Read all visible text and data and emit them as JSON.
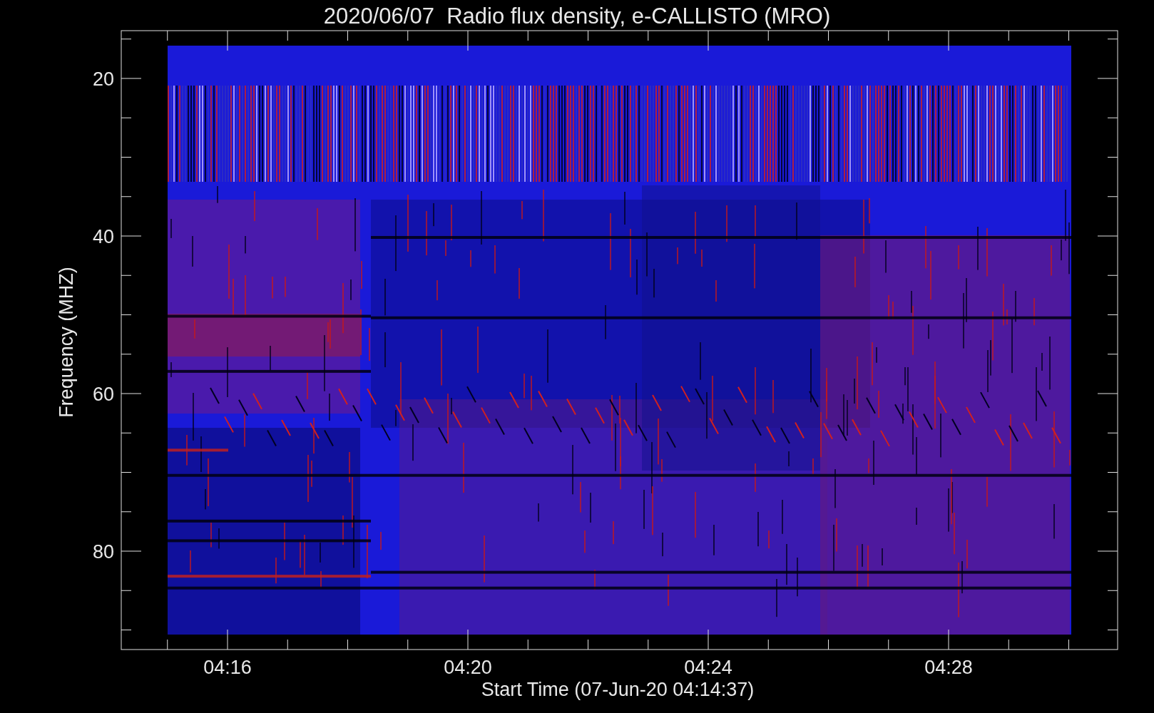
{
  "plot": {
    "title": "2020/06/07  Radio flux density, e-CALLISTO (MRO)",
    "ylabel": "Frequency (MHZ)",
    "xlabel": "Start Time (07-Jun-20 04:14:37)",
    "yticks": [
      "20",
      "40",
      "60",
      "80"
    ],
    "xticks": [
      "04:16",
      "04:20",
      "04:24",
      "04:28"
    ]
  }
}
